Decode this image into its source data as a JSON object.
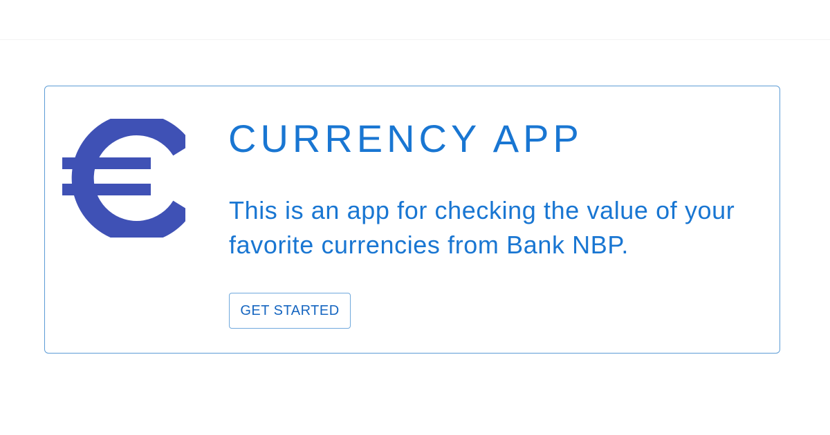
{
  "app": {
    "title": "CURRENCY APP",
    "description": "This is an app for checking the value of your favorite currencies from Bank NBP.",
    "cta_label": "GET STARTED",
    "logo_icon": "euro-icon",
    "colors": {
      "primary": "#1976d2",
      "logo": "#3f51b5",
      "border": "#5b9bd5"
    }
  }
}
